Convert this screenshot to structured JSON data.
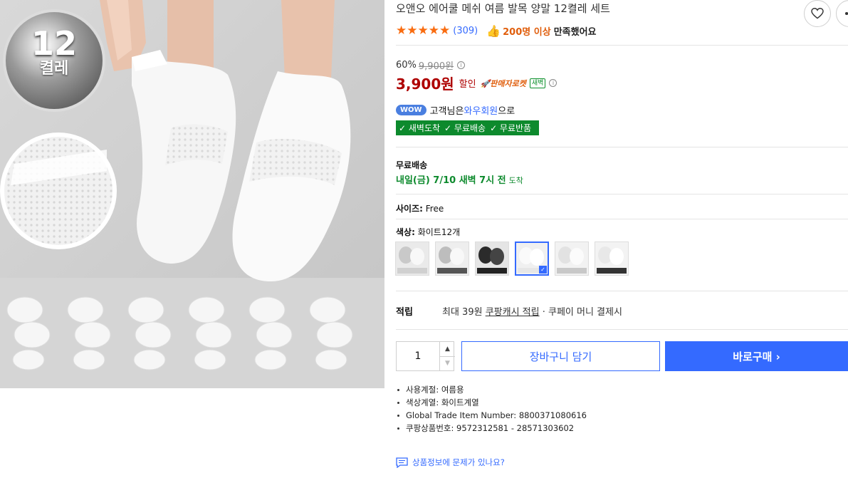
{
  "product": {
    "title": "오앤오 에어쿨 메쉬 여름 발목 양말 12켤레 세트",
    "badge_number": "12",
    "badge_unit": "켤레"
  },
  "rating": {
    "stars": 5,
    "review_count": "(309)",
    "satisfaction_strong": "200명 이상",
    "satisfaction_rest": "만족했어요"
  },
  "price": {
    "discount_rate": "60%",
    "original": "9,900원",
    "sale": "3,900원",
    "sale_label": "할인",
    "rocket_label": "🚀판매자로켓",
    "dawn_label": "새벽"
  },
  "membership": {
    "wow_badge": "WOW",
    "prefix": "고객님은 ",
    "member_name": "와우회원",
    "suffix": "으로",
    "benefits": [
      "✓ 새벽도착",
      "✓ 무료배송",
      "✓ 무료반품"
    ]
  },
  "shipping": {
    "label": "무료배송",
    "date": "내일(금) 7/10 새벽 7시 전",
    "arrive": "도착"
  },
  "options": {
    "size_label": "사이즈:",
    "size_value": "Free",
    "color_label": "색상:",
    "color_value": "화이트12개",
    "swatch_count": 6,
    "selected_index": 3
  },
  "points": {
    "label": "적립",
    "prefix": "최대 39원 ",
    "cash_link": "쿠팡캐시 적립",
    "suffix": " · 쿠페이 머니 결제시"
  },
  "purchase": {
    "quantity": "1",
    "cart_label": "장바구니 담기",
    "buy_label": "바로구매 ›"
  },
  "attributes": [
    "사용계절: 여름용",
    "색상계열: 화이트계열",
    "Global Trade Item Number: 8800371080616",
    "쿠팡상품번호: 9572312581 - 28571303602"
  ],
  "report_text": "상품정보에 문제가 있나요?",
  "colors": {
    "accent": "#346aff",
    "price_red": "#ae0000",
    "green": "#0d8a2d",
    "star_orange": "#f96c10"
  }
}
